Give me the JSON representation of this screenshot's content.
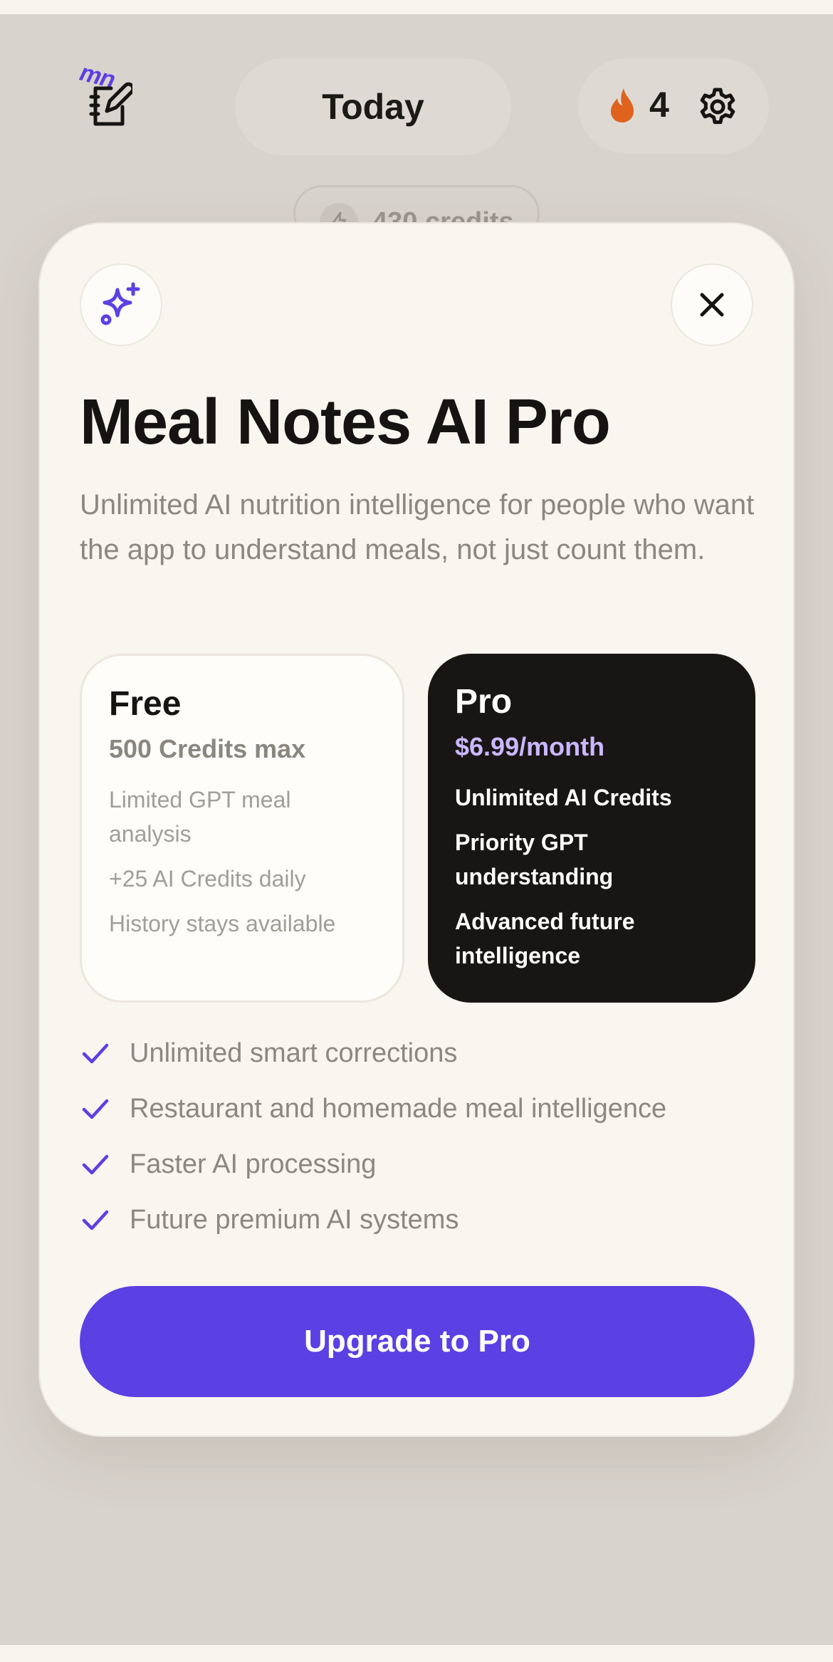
{
  "app": {
    "logo_text": "mn"
  },
  "header": {
    "date_label": "Today",
    "streak_count": "4",
    "credits_label": "430 credits"
  },
  "modal": {
    "title": "Meal Notes AI Pro",
    "subtitle": "Unlimited AI nutrition intelligence for people who want the app to understand meals, not just count them.",
    "plans": [
      {
        "name": "Free",
        "price": "500 Credits max",
        "features": [
          "Limited GPT meal analysis",
          "+25 AI Credits daily",
          "History stays available"
        ]
      },
      {
        "name": "Pro",
        "price": "$6.99/month",
        "features": [
          "Unlimited AI Credits",
          "Priority GPT understanding",
          "Advanced future intelligence"
        ]
      }
    ],
    "benefits": [
      "Unlimited smart corrections",
      "Restaurant and homemade meal intelligence",
      "Faster AI processing",
      "Future premium AI systems"
    ],
    "cta_label": "Upgrade to Pro"
  },
  "icons": {
    "logo": "notebook-pencil-icon",
    "streak": "flame-icon",
    "settings": "gear-icon",
    "credits": "lightning-icon",
    "sparkle": "sparkle-icon",
    "close": "close-icon",
    "check": "check-icon"
  },
  "colors": {
    "accent": "#5b40e3",
    "flame": "#e0621f",
    "pro_price": "#c9b8ff",
    "pro_card": "#181614",
    "backdrop": "#d8d3cc",
    "card": "#f9f5ef"
  }
}
